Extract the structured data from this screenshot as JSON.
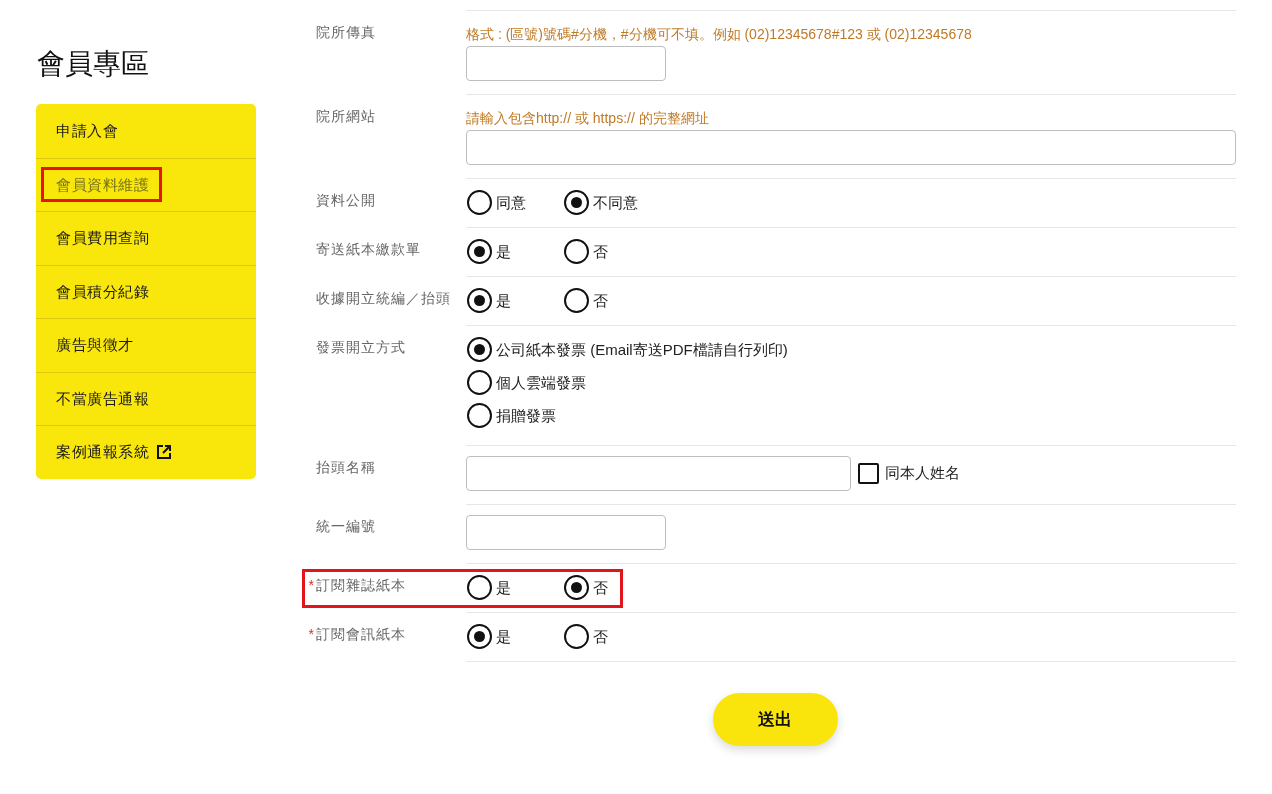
{
  "sidebar": {
    "title": "會員專區",
    "items": [
      {
        "label": "申請入會",
        "selected": false,
        "highlighted": false,
        "external": false
      },
      {
        "label": "會員資料維護",
        "selected": true,
        "highlighted": true,
        "external": false
      },
      {
        "label": "會員費用查詢",
        "selected": false,
        "highlighted": false,
        "external": false
      },
      {
        "label": "會員積分紀錄",
        "selected": false,
        "highlighted": false,
        "external": false
      },
      {
        "label": "廣告與徵才",
        "selected": false,
        "highlighted": false,
        "external": false
      },
      {
        "label": "不當廣告通報",
        "selected": false,
        "highlighted": false,
        "external": false
      },
      {
        "label": "案例通報系統",
        "selected": false,
        "highlighted": false,
        "external": true
      }
    ]
  },
  "form": {
    "rows": [
      {
        "kind": "short_input",
        "label": "院所傳真",
        "highlighted": false,
        "hint": "格式 : (區號)號碼#分機，#分機可不填。例如 (02)12345678#123 或 (02)12345678"
      },
      {
        "kind": "wide_input",
        "label": "院所網站",
        "highlighted": false,
        "hint": "請輸入包含http:// 或 https:// 的完整網址"
      },
      {
        "kind": "radio_row",
        "label": "資料公開",
        "highlighted": false,
        "options": [
          {
            "label": "同意",
            "selected": false
          },
          {
            "label": "不同意",
            "selected": true
          }
        ]
      },
      {
        "kind": "radio_row",
        "label": "寄送紙本繳款單",
        "highlighted": false,
        "options": [
          {
            "label": "是",
            "selected": true
          },
          {
            "label": "否",
            "selected": false
          }
        ]
      },
      {
        "kind": "radio_row",
        "label": "收據開立統編／抬頭",
        "highlighted": false,
        "options": [
          {
            "label": "是",
            "selected": true
          },
          {
            "label": "否",
            "selected": false
          }
        ]
      },
      {
        "kind": "radio_column",
        "label": "發票開立方式",
        "highlighted": false,
        "options": [
          {
            "label": "公司紙本發票 (Email寄送PDF檔請自行列印)",
            "selected": true
          },
          {
            "label": "個人雲端發票",
            "selected": false
          },
          {
            "label": "捐贈發票",
            "selected": false
          }
        ]
      },
      {
        "kind": "input_with_checkbox",
        "label": "抬頭名稱",
        "highlighted": false,
        "checkbox": {
          "label": "同本人姓名",
          "checked": false
        }
      },
      {
        "kind": "short_input",
        "label": "統一編號",
        "highlighted": false
      },
      {
        "kind": "radio_row",
        "label": "訂閱雜誌紙本",
        "required_mark": "*",
        "highlighted": true,
        "options": [
          {
            "label": "是",
            "selected": false
          },
          {
            "label": "否",
            "selected": true
          }
        ]
      },
      {
        "kind": "radio_row",
        "label": "訂閱會訊紙本",
        "required_mark": "*",
        "highlighted": false,
        "options": [
          {
            "label": "是",
            "selected": true
          },
          {
            "label": "否",
            "selected": false
          }
        ]
      }
    ]
  },
  "submit": {
    "label": "送出"
  }
}
